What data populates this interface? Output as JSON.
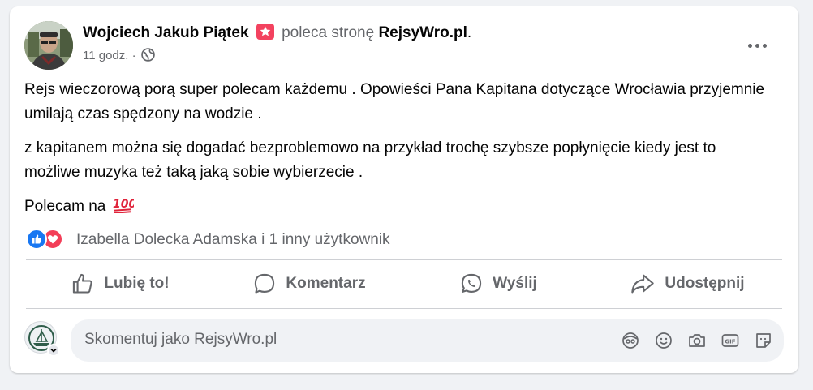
{
  "post": {
    "author": "Wojciech Jakub Piątek",
    "verb": "poleca stronę",
    "page": "RejsyWro.pl",
    "page_suffix": ".",
    "time": "11 godz.",
    "separator": "·",
    "visibility_icon": "globe-icon",
    "paragraphs": [
      "Rejs wieczorową porą super polecam każdemu . Opowieści Pana Kapitana dotyczące Wrocławia przyjemnie umilają czas spędzony na wodzie .",
      "z kapitanem można się dogadać bezproblemowo na przykład trochę szybsze popłynięcie kiedy jest to możliwe muzyka też taką jaką sobie wybierzecie ."
    ],
    "last_paragraph": "Polecam na",
    "emoji": "💯"
  },
  "reactions": {
    "icons": [
      "like-reaction-icon",
      "love-reaction-icon"
    ],
    "text": "Izabella Dolecka Adamska i 1 inny użytkownik"
  },
  "actions": {
    "like": "Lubię to!",
    "comment": "Komentarz",
    "send": "Wyślij",
    "share": "Udostępnij"
  },
  "comment_box": {
    "placeholder": "Skomentuj jako RejsyWro.pl",
    "icons": [
      "avatar-sticker-icon",
      "emoji-icon",
      "camera-icon",
      "gif-icon",
      "sticker-icon"
    ]
  },
  "colors": {
    "background": "#f0f2f5",
    "card": "#ffffff",
    "secondary_text": "#65676b",
    "like_blue": "#1877f2",
    "love_red": "#f33e58",
    "recommend_pink": "#f3425f"
  }
}
